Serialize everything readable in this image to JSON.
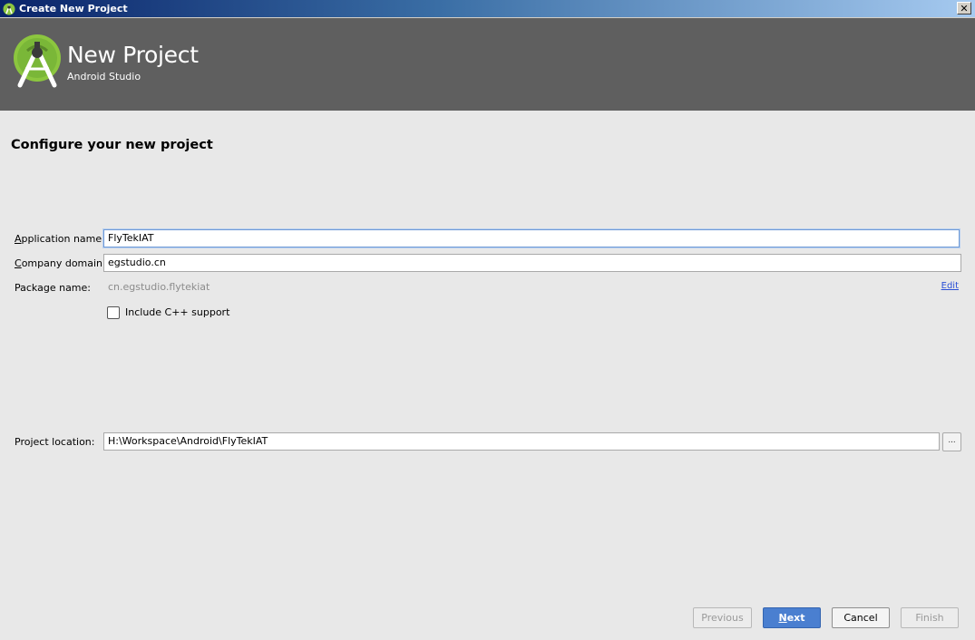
{
  "window": {
    "title": "Create New Project",
    "close_glyph": "✕"
  },
  "banner": {
    "heading": "New Project",
    "subheading": "Android Studio"
  },
  "section_title": "Configure your new project",
  "form": {
    "app_name": {
      "label": "Application name:",
      "value": "FlyTekIAT"
    },
    "company_domain": {
      "label": "Company domain:",
      "value": "egstudio.cn"
    },
    "package_name": {
      "label": "Package name:",
      "value": "cn.egstudio.flytekiat",
      "edit_label": "Edit"
    },
    "cpp_support": {
      "label": "Include C++ support",
      "checked": false
    },
    "project_location": {
      "label": "Project location:",
      "value": "H:\\Workspace\\Android\\FlyTekIAT",
      "browse_label": "..."
    }
  },
  "buttons": {
    "previous": "Previous",
    "next": "Next",
    "cancel": "Cancel",
    "finish": "Finish"
  },
  "colors": {
    "banner_bg": "#5f5f5f",
    "logo_green": "#8cc63f",
    "primary_button": "#4a7fd0",
    "link": "#2a4fd6"
  }
}
